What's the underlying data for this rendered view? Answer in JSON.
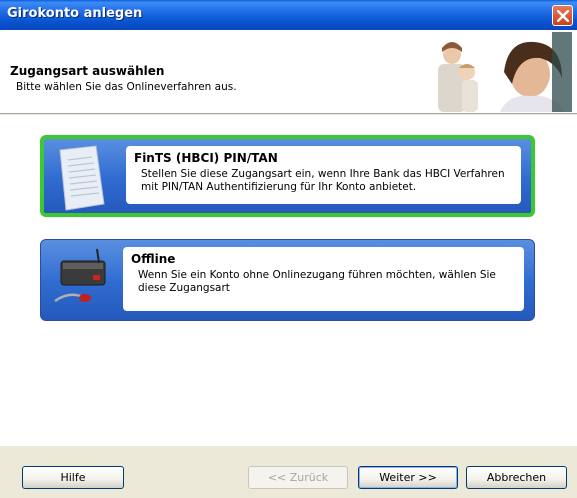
{
  "window": {
    "title": "Girokonto anlegen"
  },
  "header": {
    "title": "Zugangsart auswählen",
    "subtitle": "Bitte wählen Sie das Onlineverfahren aus."
  },
  "options": [
    {
      "title": "FinTS (HBCI) PIN/TAN",
      "description": "Stellen Sie diese Zugangsart ein, wenn Ihre Bank das HBCI Verfahren mit PIN/TAN Authentifizierung für Ihr Konto anbietet.",
      "icon": "tan-list-icon",
      "selected": true
    },
    {
      "title": "Offline",
      "description": "Wenn Sie ein Konto ohne Onlinezugang führen möchten, wählen Sie diese Zugangsart",
      "icon": "router-offline-icon",
      "selected": false
    }
  ],
  "footer": {
    "help_label": "Hilfe",
    "back_label": "<< Zurück",
    "next_label": "Weiter >>",
    "cancel_label": "Abbrechen"
  },
  "colors": {
    "titlebar": "#0A55D0",
    "selected_border": "#3CC830",
    "option_blue": "#2F6BD0",
    "dialog_bg": "#ECE9D8"
  }
}
